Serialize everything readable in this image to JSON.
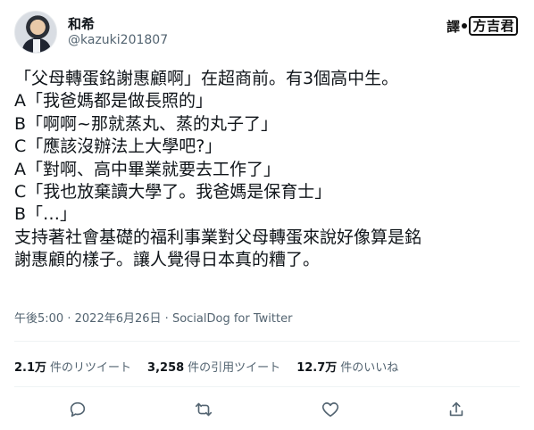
{
  "user": {
    "display_name": "和希",
    "handle": "@kazuki201807"
  },
  "badge": {
    "left": "譯",
    "right": "方吉君"
  },
  "tweet": {
    "lines": [
      "「父母轉蛋銘謝惠顧啊」在超商前。有3個高中生。",
      "A「我爸媽都是做長照的」",
      "B「啊啊~那就蒸丸、蒸的丸子了」",
      "C「應該沒辦法上大學吧?」",
      "A「對啊、高中畢業就要去工作了」",
      "C「我也放棄讀大學了。我爸媽是保育士」",
      "B「…」",
      "支持著社會基礎的福利事業對父母轉蛋來說好像算是銘",
      "謝惠顧的樣子。讓人覺得日本真的糟了。"
    ]
  },
  "meta": {
    "time": "午後5:00",
    "separator": "·",
    "date": "2022年6月26日",
    "source": "SocialDog for Twitter"
  },
  "stats": {
    "retweets": {
      "count": "2.1万",
      "label": "件のリツイート"
    },
    "quotes": {
      "count": "3,258",
      "label": "件の引用ツイート"
    },
    "likes": {
      "count": "12.7万",
      "label": "件のいいね"
    }
  },
  "actions": [
    "reply-icon",
    "retweet-icon",
    "like-icon",
    "share-icon"
  ]
}
